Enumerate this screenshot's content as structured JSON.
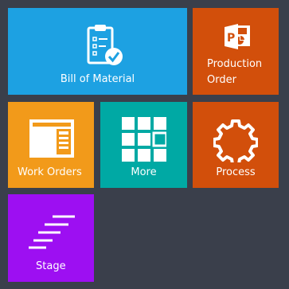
{
  "tiles": {
    "bill_of_material": {
      "label": "Bill of Material",
      "color": "#1da1e2",
      "icon": "clipboard-check-icon"
    },
    "production_order": {
      "label_line1": "Production",
      "label_line2": "Order",
      "color": "#d24f0b",
      "icon": "powerpoint-icon"
    },
    "work_orders": {
      "label": "Work Orders",
      "color": "#f29a1a",
      "icon": "document-layout-icon"
    },
    "more": {
      "label": "More",
      "color": "#00a9a4",
      "icon": "grid-icon"
    },
    "process": {
      "label": "Process",
      "color": "#d24f0b",
      "icon": "gear-icon"
    },
    "stage": {
      "label": "Stage",
      "color": "#9d0ff2",
      "icon": "stairs-icon"
    }
  }
}
